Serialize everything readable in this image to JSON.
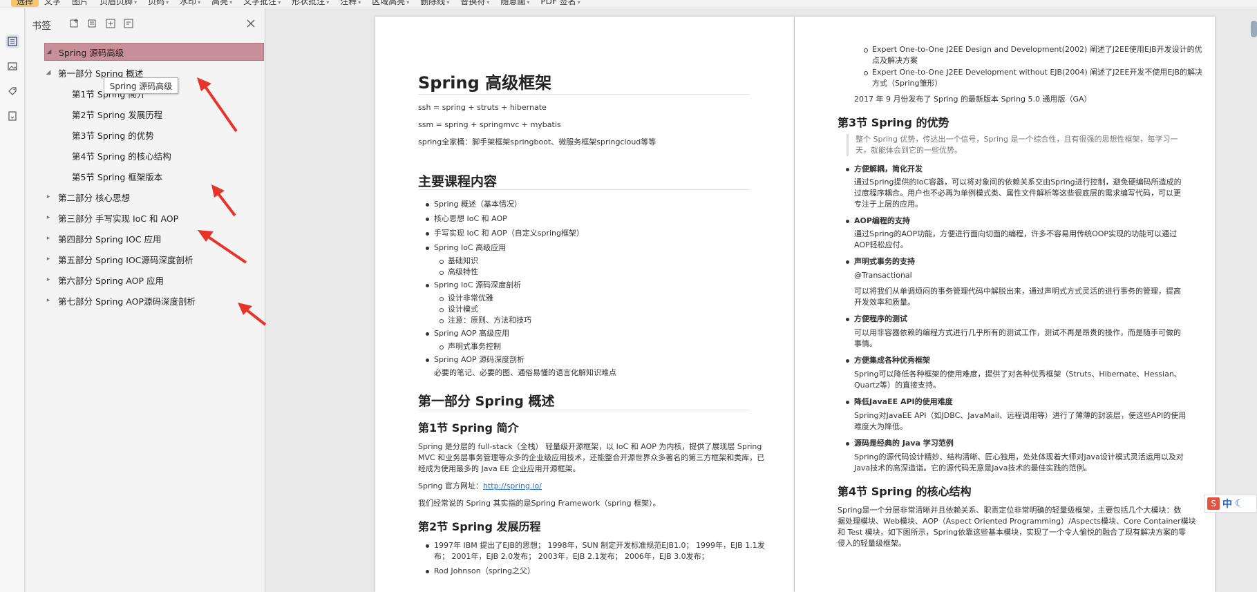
{
  "toolbar": {
    "items": [
      {
        "label": "选择",
        "selected": true
      },
      {
        "label": "文字"
      },
      {
        "label": "图片"
      },
      {
        "label": "页眉页脚"
      },
      {
        "label": "页码"
      },
      {
        "label": "水印"
      },
      {
        "label": "高亮"
      },
      {
        "label": "文字批注"
      },
      {
        "label": "形状批注"
      },
      {
        "label": "注释"
      },
      {
        "label": "区域高亮"
      },
      {
        "label": "删除线"
      },
      {
        "label": "替换符"
      },
      {
        "label": "随意画"
      },
      {
        "label": "PDF 签名"
      }
    ]
  },
  "panel": {
    "title": "书签",
    "tooltip": "Spring 源码高级",
    "tree": {
      "root": "Spring 源码高级",
      "part1": "第一部分 Spring 概述",
      "s1": "第1节 Spring 简介",
      "s2": "第2节 Spring 发展历程",
      "s3": "第3节 Spring 的优势",
      "s4": "第4节 Spring 的核心结构",
      "s5": "第5节 Spring 框架版本",
      "part2": "第二部分 核心思想",
      "part3": "第三部分 手写实现 IoC 和 AOP",
      "part4": "第四部分 Spring IOC 应用",
      "part5": "第五部分 Spring IOC源码深度剖析",
      "part6": "第六部分 Spring AOP 应用",
      "part7": "第七部分 Spring AOP源码深度剖析"
    }
  },
  "page1": {
    "title": "Spring 高级框架",
    "lines": [
      "ssh = spring + struts + hibernate",
      "ssm = spring + springmvc + mybatis",
      "spring全家桶：脚手架框架springboot、微服务框架springcloud等等"
    ],
    "course_heading": "主要课程内容",
    "course_items": [
      "Spring 概述（基本情况）",
      "核心思想 IoC 和 AOP",
      "手写实现 IoC 和 AOP（自定义spring框架）",
      "Spring IoC 高级应用",
      "基础知识",
      "高级特性",
      "Spring IoC 源码深度剖析",
      "设计非常优雅",
      "设计模式",
      "注意：原则、方法和技巧",
      "Spring AOP 高级应用",
      "声明式事务控制",
      "Spring AOP 源码深度剖析",
      "必要的笔记、必要的图、通俗易懂的语言化解知识难点"
    ],
    "part1_heading": "第一部分 Spring 概述",
    "s1_heading": "第1节 Spring 简介",
    "s1_para": [
      "Spring 是分层的 full-stack（全栈） 轻量级开源框架，以 IoC 和 AOP 为内核，提供了展现层 Spring",
      "MVC 和业务层事务管理等众多的企业级应用技术，还能整合开源世界众多著名的第三方框架和类库，已",
      "经成为使用最多的 Java EE 企业应用开源框架。"
    ],
    "site_label": "Spring 官方网址：",
    "site_url": "http://spring.io/",
    "framework_line": "我们经常说的 Spring 其实指的是Spring Framework（spring 框架）。",
    "s2_heading": "第2节 Spring 发展历程",
    "history": [
      "1997年 IBM 提出了EJB的思想； 1998年，SUN 制定开发标准规范EJB1.0； 1999年，EJB 1.1发",
      "布； 2001年，EJB 2.0发布； 2003年，EJB 2.1发布； 2006年，EJB 3.0发布；",
      "Rod Johnson（spring之父）"
    ]
  },
  "page2": {
    "books": [
      "Expert One-to-One J2EE Design and Development(2002) 阐述了J2EE使用EJB开发设计的优",
      "点及解决方案",
      "Expert One-to-One J2EE Development without EJB(2004) 阐述了J2EE开发不使用EJB的解决",
      "方式（Spring雏形）"
    ],
    "release_line": "2017 年 9 月份发布了 Spring 的最新版本 Spring 5.0 通用版（GA）",
    "s3_heading": "第3节 Spring 的优势",
    "quote": [
      "整个 Spring 优势，传达出一个信号，Spring 是一个综合性，且有很强的思想性框架，每学习一",
      "天，就能体会到它的一些优势。"
    ],
    "adv": [
      {
        "title": "方便解耦，简化开发",
        "body": [
          "通过Spring提供的IoC容器，可以将对象间的依赖关系交由Spring进行控制，避免硬编码所造成的",
          "过度程序耦合。用户也不必再为单例模式类、属性文件解析等这些很底层的需求编写代码，可以更",
          "专注于上层的应用。"
        ]
      },
      {
        "title": "AOP编程的支持",
        "body": [
          "通过Spring的AOP功能，方便进行面向切面的编程，许多不容易用传统OOP实现的功能可以通过",
          "AOP轻松应付。"
        ]
      },
      {
        "title": "声明式事务的支持",
        "body": [
          "@Transactional",
          "可以将我们从单调烦闷的事务管理代码中解脱出来，通过声明式方式灵活的进行事务的管理，提高",
          "开发效率和质量。"
        ]
      },
      {
        "title": "方便程序的测试",
        "body": [
          "可以用非容器依赖的编程方式进行几乎所有的测试工作，测试不再是昂贵的操作，而是随手可做的",
          "事情。"
        ]
      },
      {
        "title": "方便集成各种优秀框架",
        "body": [
          "Spring可以降低各种框架的使用难度，提供了对各种优秀框架（Struts、Hibernate、Hessian、",
          "Quartz等）的直接支持。"
        ]
      },
      {
        "title": "降低JavaEE API的使用难度",
        "body": [
          "Spring对JavaEE API（如JDBC、JavaMail、远程调用等）进行了薄薄的封装层，使这些API的使用",
          "难度大为降低。"
        ]
      },
      {
        "title": "源码是经典的 Java 学习范例",
        "body": [
          "Spring的源代码设计精妙、结构清晰、匠心独用，处处体现着大师对Java设计模式灵活运用以及对",
          "Java技术的高深造诣。它的源代码无意是Java技术的最佳实践的范例。"
        ]
      }
    ],
    "s4_heading": "第4节 Spring 的核心结构",
    "s4_para": [
      "Spring是一个分层非常清晰并且依赖关系、职责定位非常明确的轻量级框架，主要包括几个大模块：数",
      "据处理模块、Web模块、AOP（Aspect Oriented Programming）/Aspects模块、Core Container模块",
      "和 Test 模块，如下图所示，Spring依靠这些基本模块，实现了一个令人愉悦的融合了现有解决方案的零",
      "侵入的轻量级框架。"
    ]
  },
  "ime": {
    "logo": "S",
    "lang": "中"
  },
  "colors": {
    "bookmark_selected": "#c98f99",
    "arrow_red": "#e8332a",
    "link": "#2a6fc9"
  }
}
